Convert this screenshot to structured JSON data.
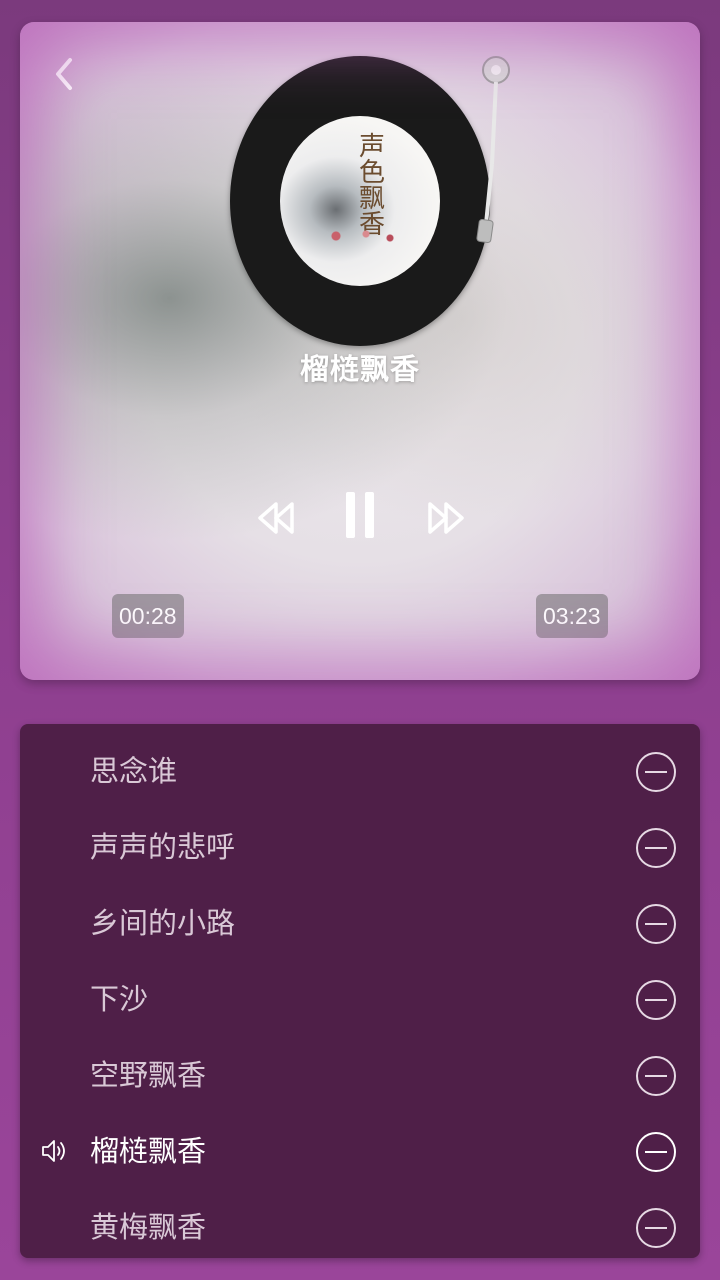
{
  "player": {
    "back_icon": "chevron-left-icon",
    "album_cover_text": "声色飘香",
    "song_title": "榴梿飘香",
    "controls": {
      "rewind_icon": "rewind-icon",
      "pause_icon": "pause-icon",
      "forward_icon": "fast-forward-icon"
    },
    "time_elapsed": "00:28",
    "time_total": "03:23"
  },
  "playlist": {
    "tracks": [
      {
        "name": "思念谁",
        "playing": false
      },
      {
        "name": "声声的悲呼",
        "playing": false
      },
      {
        "name": "乡间的小路",
        "playing": false
      },
      {
        "name": "下沙",
        "playing": false
      },
      {
        "name": "空野飘香",
        "playing": false
      },
      {
        "name": "榴梿飘香",
        "playing": true
      },
      {
        "name": "黄梅飘香",
        "playing": false
      }
    ],
    "remove_icon": "minus-circle-icon",
    "playing_icon": "speaker-icon"
  },
  "colors": {
    "background": "#8e3f8f",
    "playlist_background": "#4f1f48",
    "track_text": "#d9c8d6",
    "active_track_text": "#ffffff"
  }
}
